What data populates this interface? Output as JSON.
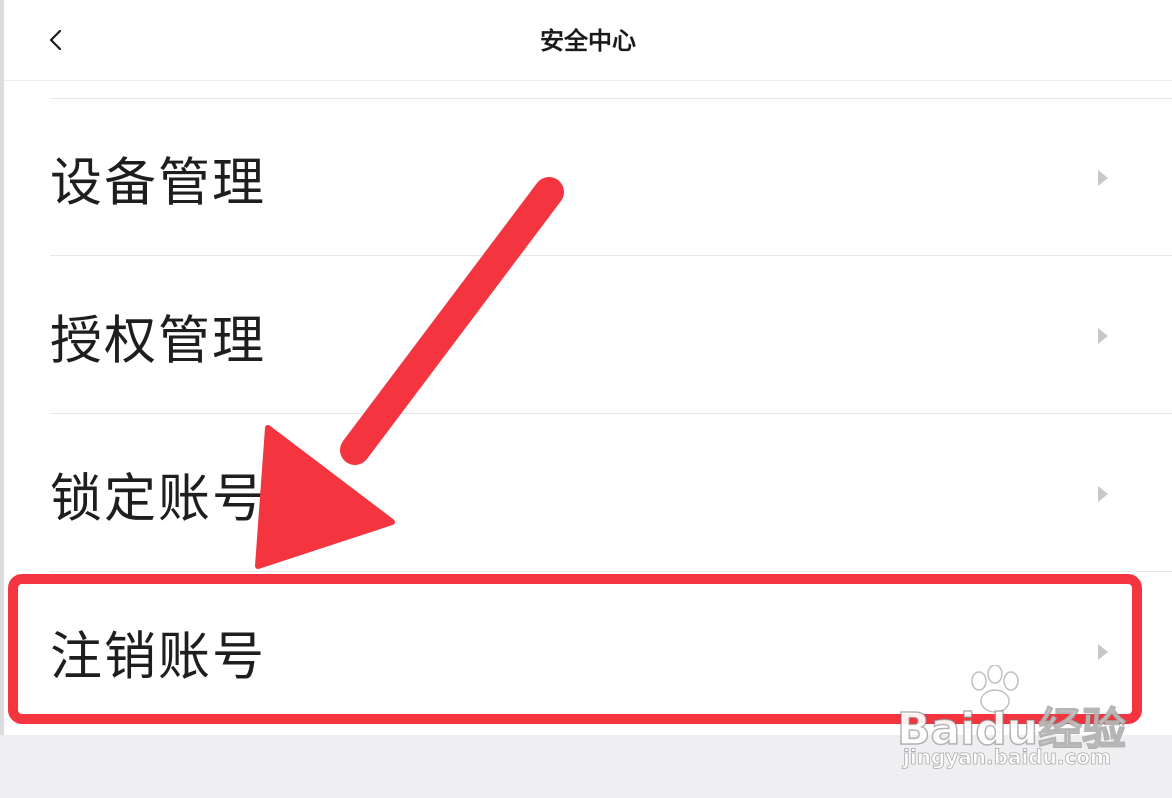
{
  "nav": {
    "title": "安全中心",
    "back_icon": "chevron-left-icon"
  },
  "menu": {
    "items": [
      {
        "label": "设备管理",
        "icon": "chevron-right-icon"
      },
      {
        "label": "授权管理",
        "icon": "chevron-right-icon"
      },
      {
        "label": "锁定账号",
        "icon": "chevron-right-icon"
      },
      {
        "label": "注销账号",
        "icon": "chevron-right-icon"
      }
    ]
  },
  "annotation": {
    "color": "#f4343f",
    "highlighted_item": "注销账号"
  },
  "watermark": {
    "brand": "Baidu经验",
    "url": "jingyan.baidu.com"
  },
  "colors": {
    "text": "#1e1e1e",
    "chevron": "#c7c7cc",
    "divider": "#e8e8e8",
    "bottom_background": "#efeff2"
  }
}
